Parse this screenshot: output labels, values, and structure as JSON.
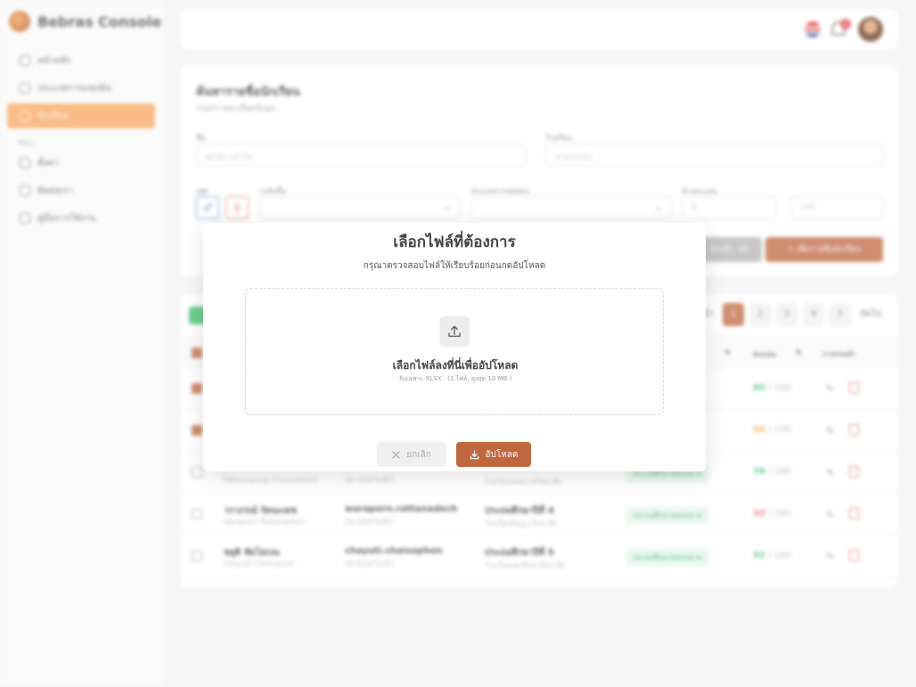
{
  "brand": {
    "name": "Bebras Console"
  },
  "sidebar": {
    "items": [
      {
        "label": "หน้าหลัก"
      },
      {
        "label": "ประเภทการแข่งขัน"
      },
      {
        "label": "นักเรียน"
      }
    ],
    "section_label": "Misc",
    "misc_items": [
      {
        "label": "ตั้งค่า"
      },
      {
        "label": "ติดต่อเรา"
      },
      {
        "label": "คู่มือการใช้งาน"
      }
    ]
  },
  "header": {
    "notification_count": "2"
  },
  "search": {
    "title": "ค้นหารายชื่อนักเรียน",
    "subtitle": "กรอกรายละเอียดข้อมูล",
    "name_label": "ชื่อ",
    "name_placeholder": "ศุภชัย แก้วใจ",
    "school_label": "โรงเรียน",
    "school_placeholder": "สาธรระนัง",
    "gender_label": "เพศ",
    "level_label": "ระดับชั้น",
    "exam_type_label": "ประเภทการทดสอบ",
    "score_label": "ช่วงคะแนน",
    "score_min": "0",
    "score_max": "100",
    "import_label": "นำเข้า .xls",
    "add_label": "+ เพิ่มรายชื่อนักเรียน"
  },
  "pagination": {
    "prev": "ก่อนหน้า",
    "pages": [
      "1",
      "2",
      "3",
      "4",
      "5"
    ],
    "next": "ถัดไป"
  },
  "table": {
    "headers": {
      "score": "คะแนน",
      "actions": "การกระทำ"
    },
    "rows": [
      {
        "name": "",
        "name_en": "",
        "username": "",
        "uid": "",
        "grade": "",
        "school": "",
        "badge": "",
        "score": "80",
        "score_color": "#3dbb6a",
        "checked": true
      },
      {
        "name": "",
        "name_en": "",
        "username": "",
        "uid": "",
        "grade": "",
        "school": "",
        "badge": "",
        "score": "56",
        "score_color": "#f0a040",
        "checked": true
      },
      {
        "name": "",
        "name_en": "Pathompong Chanyawichit",
        "username": "",
        "uid": "bb-Q3sF5zW1",
        "grade": "",
        "school": "โรงเรียนเทศบาลวิทยาลัย",
        "badge": "ประถมศึกษาตอนปลาย",
        "score": "78",
        "score_color": "#3dbb6a",
        "checked": false
      },
      {
        "name": "วราภรณ์ รัตนะเดช",
        "name_en": "Waraporn Rattanadech",
        "username": "waraporn.rattanadech",
        "uid": "bb-Q3sF5zW1",
        "grade": "ประถมศึกษาปีที่ 4",
        "school": "โรงเรียนอัญญาวิทยาลัย",
        "badge": "ประถมศึกษาตอนปลาย",
        "score": "32",
        "score_color": "#e05555",
        "checked": false
      },
      {
        "name": "ชยุติ ชัยโสภณ",
        "name_en": "Chayuti Chaisophon",
        "username": "chayuti.chaisophon",
        "uid": "bb-Q3sF5zW1",
        "grade": "ประถมศึกษาปีที่ 5",
        "school": "โรงเรียนเอกศึกษาวิทยาลัย",
        "badge": "ประถมศึกษาตอนปลาย",
        "score": "92",
        "score_color": "#3dbb6a",
        "checked": false
      }
    ],
    "max_score": "/ 100"
  },
  "modal": {
    "title": "เลือกไฟล์ที่ต้องการ",
    "subtitle": "กรุณาตรวจสอบไฟล์ให้เรียบร้อยก่อนกดอัปโหลด",
    "dropzone_title": "เลือกไฟล์ลงที่นี่เพื่ออัปโหลด",
    "dropzone_hint": "รับเฉพาะ XLSX . (1 ไฟล์, สูงสุด 10 MB )",
    "cancel_label": "ยกเลิก",
    "upload_label": "อัปโหลด"
  }
}
